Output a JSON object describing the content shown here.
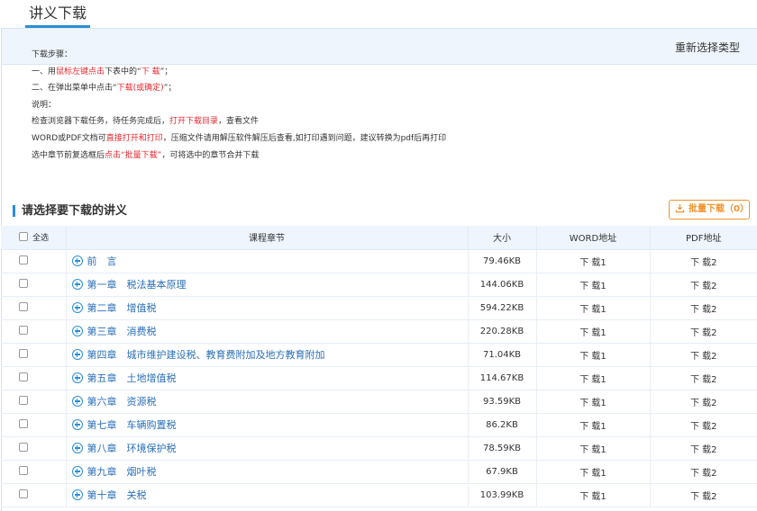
{
  "tab": {
    "title": "讲义下载"
  },
  "type_bar": {
    "reselect_label": "重新选择类型"
  },
  "instructions": {
    "l1": "下载步骤：",
    "l2a": "一、用",
    "l2b": "鼠标左键点击",
    "l2c": "下表中的“",
    "l2d": "下 载",
    "l2e": "”；",
    "l3a": "二、在弹出菜单中点击“",
    "l3b": "下载(或确定)",
    "l3c": "”；",
    "l4": "说明：",
    "l5a": "检查浏览器下载任务，待任务完成后，",
    "l5b": "打开下载目录",
    "l5c": "，查看文件",
    "l6a": "WORD或PDF文档可",
    "l6b": "直接打开和打印",
    "l6c": "，压缩文件请用解压软件解压后查看,如打印遇到问题，建议转换为pdf后再打印",
    "l7a": "选中章节前复选框后",
    "l7b": "点击“批量下载”",
    "l7c": "，可将选中的章节合并下载"
  },
  "section": {
    "title": "请选择要下载的讲义",
    "batch_label": "批量下载（0）"
  },
  "table": {
    "headers": {
      "select_all": "全选",
      "chapter": "课程章节",
      "size": "大小",
      "word": "WORD地址",
      "pdf": "PDF地址"
    },
    "rows": [
      {
        "chapter": "前　言",
        "size": "79.46KB",
        "word": "下 载1",
        "pdf": "下 载2"
      },
      {
        "chapter": "第一章　税法基本原理",
        "size": "144.06KB",
        "word": "下 载1",
        "pdf": "下 载2"
      },
      {
        "chapter": "第二章　增值税",
        "size": "594.22KB",
        "word": "下 载1",
        "pdf": "下 载2"
      },
      {
        "chapter": "第三章　消费税",
        "size": "220.28KB",
        "word": "下 载1",
        "pdf": "下 载2"
      },
      {
        "chapter": "第四章　城市维护建设税、教育费附加及地方教育附加",
        "size": "71.04KB",
        "word": "下 载1",
        "pdf": "下 载2"
      },
      {
        "chapter": "第五章　土地增值税",
        "size": "114.67KB",
        "word": "下 载1",
        "pdf": "下 载2"
      },
      {
        "chapter": "第六章　资源税",
        "size": "93.59KB",
        "word": "下 载1",
        "pdf": "下 载2"
      },
      {
        "chapter": "第七章　车辆购置税",
        "size": "86.2KB",
        "word": "下 载1",
        "pdf": "下 载2"
      },
      {
        "chapter": "第八章　环境保护税",
        "size": "78.59KB",
        "word": "下 载1",
        "pdf": "下 载2"
      },
      {
        "chapter": "第九章　烟叶税",
        "size": "67.9KB",
        "word": "下 载1",
        "pdf": "下 载2"
      },
      {
        "chapter": "第十章　关税",
        "size": "103.99KB",
        "word": "下 载1",
        "pdf": "下 载2"
      }
    ]
  },
  "colors": {
    "accent": "#2a8fd6",
    "highlight": "#e8262d",
    "batch": "#f0922c",
    "header_bg": "#eef5fc"
  }
}
